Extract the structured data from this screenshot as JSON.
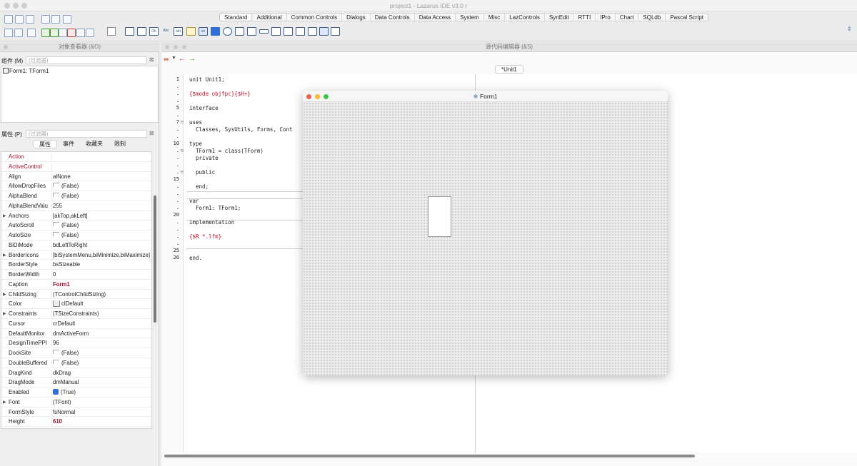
{
  "app": {
    "title": "project1 - Lazarus IDE v3.0 r"
  },
  "palette": {
    "tabs": [
      "Standard",
      "Additional",
      "Common Controls",
      "Dialogs",
      "Data Controls",
      "Data Access",
      "System",
      "Misc",
      "LazControls",
      "SynEdit",
      "RTTI",
      "IPro",
      "Chart",
      "SQLdb",
      "Pascal Script"
    ],
    "active_tab": "Standard",
    "component_icons": [
      "frames-icon",
      "main-menu-icon",
      "popup-menu-icon",
      "button-icon",
      "label-icon",
      "edit-icon",
      "memo-icon",
      "toggle-box-icon",
      "checkbox-icon",
      "radio-button-icon",
      "listbox-icon",
      "combobox-icon",
      "scrollbar-icon",
      "groupbox-icon",
      "radiogroup-icon",
      "checkgroup-icon",
      "panel-icon",
      "frame-icon",
      "actionlist-icon"
    ],
    "icon_texts": {
      "button": "Ok",
      "label": "Abc",
      "edit": "abI",
      "toggle": "on"
    }
  },
  "object_inspector": {
    "title": "对象查看器 (&O)",
    "components_label": "组件 (M)",
    "filter_placeholder": "(过滤器)",
    "tree_item": "Form1: TForm1",
    "properties_label": "属性 (P)",
    "tabs": [
      "属性",
      "事件",
      "收藏夹",
      "限制"
    ],
    "active_tab": "属性",
    "rows": [
      {
        "name": "Action",
        "value": "",
        "highlight": true
      },
      {
        "name": "ActiveControl",
        "value": "",
        "highlight": true
      },
      {
        "name": "Align",
        "value": "alNone"
      },
      {
        "name": "AllowDropFiles",
        "value": "(False)",
        "check": "off"
      },
      {
        "name": "AlphaBlend",
        "value": "(False)",
        "check": "off"
      },
      {
        "name": "AlphaBlendValu",
        "value": "255"
      },
      {
        "name": "Anchors",
        "value": "[akTop,akLeft]",
        "expand": true
      },
      {
        "name": "AutoScroll",
        "value": "(False)",
        "check": "off"
      },
      {
        "name": "AutoSize",
        "value": "(False)",
        "check": "off"
      },
      {
        "name": "BiDiMode",
        "value": "bdLeftToRight"
      },
      {
        "name": "BorderIcons",
        "value": "[biSystemMenu,biMinimize,biMaximize]",
        "expand": true
      },
      {
        "name": "BorderStyle",
        "value": "bsSizeable"
      },
      {
        "name": "BorderWidth",
        "value": "0"
      },
      {
        "name": "Caption",
        "value": "Form1",
        "bold": true
      },
      {
        "name": "ChildSizing",
        "value": "(TControlChildSizing)",
        "expand": true
      },
      {
        "name": "Color",
        "value": "clDefault",
        "swatch": true
      },
      {
        "name": "Constraints",
        "value": "(TSizeConstraints)",
        "expand": true
      },
      {
        "name": "Cursor",
        "value": "crDefault"
      },
      {
        "name": "DefaultMonitor",
        "value": "dmActiveForm"
      },
      {
        "name": "DesignTimePPI",
        "value": "96"
      },
      {
        "name": "DockSite",
        "value": "(False)",
        "check": "off"
      },
      {
        "name": "DoubleBuffered",
        "value": "(False)",
        "check": "off"
      },
      {
        "name": "DragKind",
        "value": "dkDrag"
      },
      {
        "name": "DragMode",
        "value": "dmManual"
      },
      {
        "name": "Enabled",
        "value": "(True)",
        "check": "on"
      },
      {
        "name": "Font",
        "value": "(TFont)",
        "expand": true
      },
      {
        "name": "FormStyle",
        "value": "fsNormal"
      },
      {
        "name": "Height",
        "value": "610",
        "bold": true
      }
    ]
  },
  "editor": {
    "title": "源代码编辑器 (&S)",
    "tab": "*Unit1",
    "line_numbers": [
      "1",
      ".",
      ".",
      ".",
      "5",
      ".",
      "7",
      ".",
      ".",
      "10",
      ".",
      ".",
      ".",
      ".",
      "15",
      ".",
      ".",
      ".",
      ".",
      "20",
      ".",
      ".",
      ".",
      ".",
      "25",
      "26"
    ],
    "lines": [
      {
        "text": "unit Unit1;"
      },
      {
        "text": ""
      },
      {
        "text": "{$mode objfpc}{$H+}",
        "directive": true
      },
      {
        "text": ""
      },
      {
        "text": "interface"
      },
      {
        "text": ""
      },
      {
        "text": "uses"
      },
      {
        "text": "  Classes, SysUtils, Forms, Cont"
      },
      {
        "text": ""
      },
      {
        "text": "type"
      },
      {
        "text": "  TForm1 = class(TForm)"
      },
      {
        "text": "  private"
      },
      {
        "text": ""
      },
      {
        "text": "  public"
      },
      {
        "text": ""
      },
      {
        "text": "  end;"
      },
      {
        "text": ""
      },
      {
        "text": "var"
      },
      {
        "text": "  Form1: TForm1;"
      },
      {
        "text": ""
      },
      {
        "text": "implementation"
      },
      {
        "text": ""
      },
      {
        "text": "{$R *.lfm}",
        "directive": true
      },
      {
        "text": ""
      },
      {
        "text": ""
      },
      {
        "text": "end."
      }
    ]
  },
  "form_designer": {
    "caption": "Form1"
  },
  "colors": {
    "highlight": "#a0102a",
    "directive": "#c0102a",
    "check": "#2f6fd8"
  }
}
